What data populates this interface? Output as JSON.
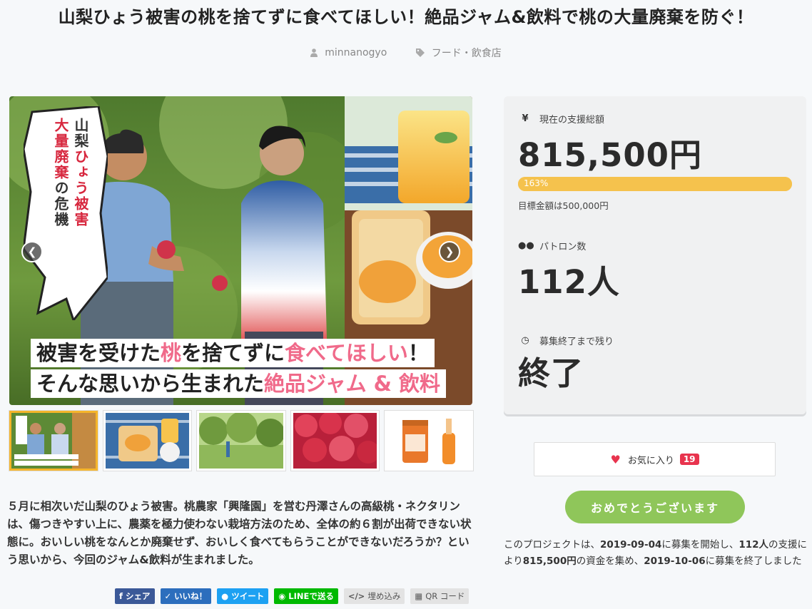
{
  "project": {
    "title": "山梨ひょう被害の桃を捨てずに食べてほしい！絶品ジャム&飲料で桃の大量廃棄を防ぐ！",
    "author": "minnanogyo",
    "category": "フード・飲食店"
  },
  "hero": {
    "bubble_lines": [
      "山梨ひょう被害",
      "大量廃棄の危機"
    ],
    "bubble_line1_a": "山梨",
    "bubble_line1_b": "ひょう被害",
    "bubble_line2_a": "大量廃棄",
    "bubble_line2_b": "の危機",
    "caption1_a": "被害を受けた",
    "caption1_b": "桃",
    "caption1_c": "を捨てずに",
    "caption1_d": "食べてほしい",
    "caption1_e": "！",
    "caption2_a": "そんな思いから生まれた",
    "caption2_b": "絶品ジャム & 飲料",
    "prev_icon": "chevron-left-icon",
    "next_icon": "chevron-right-icon"
  },
  "thumbnails": [
    {
      "name": "farmers-photo",
      "active": true
    },
    {
      "name": "jam-toast-photo",
      "active": false
    },
    {
      "name": "orchard-photo",
      "active": false
    },
    {
      "name": "peaches-photo",
      "active": false
    },
    {
      "name": "jam-bottle-photo",
      "active": false
    }
  ],
  "description": "５月に相次いだ山梨のひょう被害。桃農家「興隆園」を営む丹澤さんの高級桃・ネクタリンは、傷つきやすい上に、農薬を極力使わない栽培方法のため、全体の約６割が出荷できない状態に。おいしい桃をなんとか廃棄せず、おいしく食べてもらうことができないだろうか？という思いから、今回のジャム&飲料が生まれました。",
  "share": {
    "facebook": "シェア",
    "hatena": "いいね！",
    "twitter": "ツイート",
    "line": "LINEで送る",
    "embed": "埋め込み",
    "qr": "QR コード"
  },
  "stats": {
    "amount_label": "現在の支援総額",
    "amount": "815,500円",
    "progress_text": "163%",
    "progress_percent": 163,
    "goal_text": "目標金額は500,000円",
    "patrons_label": "パトロン数",
    "patrons": "112人",
    "remaining_label": "募集終了まで残り",
    "remaining": "終了"
  },
  "favorite": {
    "label": "お気に入り",
    "count": "19"
  },
  "congrats_label": "おめでとうございます",
  "summary": {
    "p1": "このプロジェクトは、",
    "start": "2019-09-04",
    "p2": "に募集を開始し、",
    "patrons": "112人",
    "p3": "の支援により",
    "amount": "815,500円",
    "p4": "の資金を集め、",
    "end": "2019-10-06",
    "p5": "に募集を終了しました"
  },
  "colors": {
    "accent_yellow": "#f5c24d",
    "congrats_green": "#8fc65a",
    "heart_red": "#e8344e",
    "caption_pink": "#f06a8a"
  }
}
